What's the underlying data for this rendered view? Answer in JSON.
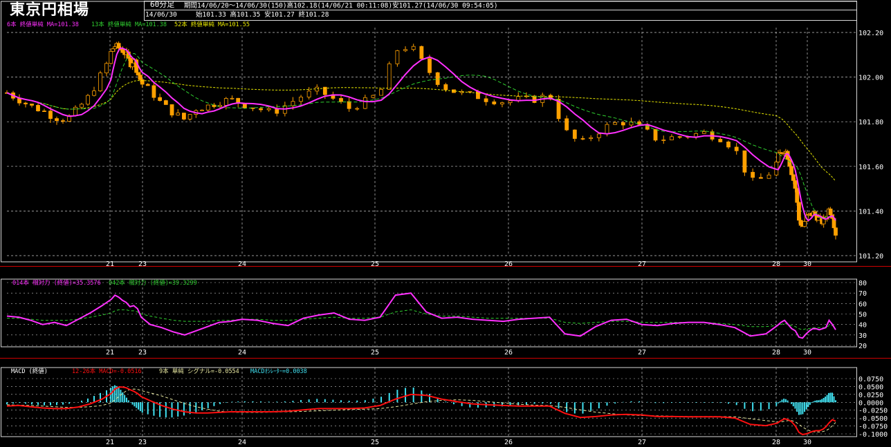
{
  "window": {
    "title": "東京円相場",
    "timeframe": "60分足",
    "period_info": "期間14/06/20～14/06/30(150)高102.18(14/06/21 00:11:08)安101.27(14/06/30 09:54:05)",
    "last_date": "14/06/30",
    "last_ohlc": "始101.33 高101.35 安101.27 終101.28"
  },
  "colors": {
    "background": "#000000",
    "grid": "#c8c8c8",
    "candle": "#ffa000",
    "ma6": "#ff30ff",
    "ma13": "#30d030",
    "ma52": "#e8e800",
    "rsi14": "#ff30ff",
    "rsi42": "#30d030",
    "macd": "#ff1010",
    "signal": "#e8e8a0",
    "histogram": "#40e0f0",
    "divider": "#d00000"
  },
  "price_panel": {
    "legend": [
      {
        "text": "6本 終値単純 MA=101.38",
        "color": "#ff30ff"
      },
      {
        "text": "13本 終値単純 MA=101.38",
        "color": "#30d030"
      },
      {
        "text": "52本 終値単純 MA=101.55",
        "color": "#e8e800"
      }
    ],
    "y_ticks": [
      "102.20",
      "102.00",
      "101.80",
      "101.60",
      "101.40",
      "101.20"
    ]
  },
  "rsi_panel": {
    "legend": [
      {
        "text": "014本 相対力 (終値)=35.3576",
        "color": "#ff30ff"
      },
      {
        "text": "042本 相対力 (終値)=39.3299",
        "color": "#30d030"
      }
    ],
    "y_ticks": [
      "80",
      "70",
      "60",
      "50",
      "40",
      "30",
      "20"
    ]
  },
  "macd_panel": {
    "legend": [
      {
        "text": "MACD (終値)",
        "color": "#ffffff"
      },
      {
        "text": "12-26本 MACD=-0.0516",
        "color": "#ff1010"
      },
      {
        "text": "9本 単純 シグナル=-0.0554",
        "color": "#e8e8a0"
      },
      {
        "text": "MACDｵｼﾚｰﾀｰ=0.0038",
        "color": "#40e0f0"
      }
    ],
    "y_ticks": [
      "0.0750",
      "0.0500",
      "0.0250",
      "0.0000",
      "-0.0250",
      "-0.0500",
      "-0.0750",
      "-0.1000"
    ]
  },
  "x_axis": {
    "date_labels": [
      "21",
      "23",
      "24",
      "25",
      "26",
      "27",
      "28",
      "30"
    ]
  },
  "chart_data": [
    {
      "type": "candlestick",
      "title": "東京円相場",
      "timeframe": "60分足",
      "x_dates": [
        "14/06/20",
        "14/06/21",
        "14/06/23",
        "14/06/24",
        "14/06/25",
        "14/06/26",
        "14/06/27",
        "14/06/28",
        "14/06/30"
      ],
      "ylim": [
        101.2,
        102.2
      ],
      "y_ticks": [
        102.2,
        102.0,
        101.8,
        101.6,
        101.4,
        101.2
      ],
      "close_path": [
        101.93,
        101.9,
        101.87,
        101.85,
        101.82,
        101.81,
        101.86,
        101.92,
        102.02,
        102.12,
        102.14,
        102.13,
        102.12,
        102.1,
        102.06,
        102.08,
        102.02,
        101.98,
        101.94,
        101.88,
        101.84,
        101.81,
        101.86,
        101.87,
        101.89,
        101.9,
        101.88,
        101.86,
        101.84,
        101.88,
        101.92,
        101.94,
        101.9,
        101.86,
        101.89,
        101.93,
        102.12,
        102.14,
        102.04,
        101.96,
        101.93,
        101.92,
        101.9,
        101.89,
        101.9,
        101.9,
        101.92,
        101.76,
        101.7,
        101.75,
        101.79,
        101.8,
        101.77,
        101.72,
        101.73,
        101.74,
        101.75,
        101.73,
        101.68,
        101.53,
        101.55,
        101.64,
        101.66,
        101.68,
        101.64,
        101.57,
        101.5,
        101.36,
        101.33,
        101.37,
        101.38,
        101.39,
        101.38,
        101.36,
        101.35,
        101.37,
        101.41,
        101.38,
        101.3
      ],
      "session_high": 102.18,
      "session_low": 101.27,
      "series": [
        {
          "name": "6本 終値単純",
          "last": 101.38
        },
        {
          "name": "13本 終値単純",
          "last": 101.38
        },
        {
          "name": "52本 終値単純",
          "last": 101.55
        }
      ],
      "last_bar": {
        "date": "14/06/30",
        "open": 101.33,
        "high": 101.35,
        "low": 101.27,
        "close": 101.28
      }
    },
    {
      "type": "line",
      "ylim": [
        20,
        80
      ],
      "y_ticks": [
        80,
        70,
        60,
        50,
        40,
        30,
        20
      ],
      "series": [
        {
          "name": "014本 相対力 (終値)",
          "last": 35.3576,
          "values": [
            48,
            47,
            44,
            40,
            42,
            39,
            45,
            51,
            58,
            64,
            68,
            66,
            63,
            61,
            57,
            58,
            55,
            47,
            40,
            37,
            33,
            30,
            34,
            38,
            42,
            43,
            45,
            44,
            41,
            39,
            46,
            49,
            51,
            45,
            44,
            47,
            68,
            70,
            52,
            46,
            47,
            45,
            44,
            43,
            45,
            46,
            47,
            31,
            29,
            38,
            44,
            45,
            40,
            39,
            41,
            42,
            42,
            40,
            37,
            29,
            31,
            39,
            42,
            44,
            40,
            36,
            34,
            28,
            27,
            31,
            34,
            36,
            36,
            35,
            36,
            37,
            44,
            40,
            35
          ]
        },
        {
          "name": "042本 相対力 (終値)",
          "last": 39.3299,
          "values": [
            46,
            46,
            45,
            44,
            44,
            44,
            45,
            47,
            49,
            51,
            53,
            54,
            54,
            54,
            53,
            53,
            52,
            50,
            48,
            46,
            44,
            43,
            43,
            43,
            44,
            44,
            45,
            45,
            44,
            44,
            45,
            46,
            47,
            46,
            46,
            47,
            52,
            54,
            50,
            48,
            48,
            47,
            46,
            46,
            46,
            46,
            46,
            42,
            41,
            42,
            43,
            43,
            42,
            42,
            42,
            42,
            42,
            41,
            40,
            38,
            38,
            39,
            40,
            41,
            40,
            39,
            38,
            36,
            35,
            36,
            36,
            37,
            37,
            37,
            37,
            37,
            39,
            39,
            39
          ]
        }
      ]
    },
    {
      "type": "line",
      "title": "MACD (終値)",
      "ylim": [
        -0.1,
        0.075
      ],
      "y_ticks": [
        0.075,
        0.05,
        0.025,
        0.0,
        -0.025,
        -0.05,
        -0.075,
        -0.1
      ],
      "series": [
        {
          "name": "12-26本 MACD",
          "last": -0.0516,
          "values": [
            -0.012,
            -0.01,
            -0.014,
            -0.018,
            -0.02,
            -0.02,
            -0.015,
            -0.005,
            0.01,
            0.028,
            0.042,
            0.048,
            0.048,
            0.046,
            0.04,
            0.035,
            0.028,
            0.018,
            0.005,
            -0.01,
            -0.022,
            -0.03,
            -0.034,
            -0.034,
            -0.032,
            -0.03,
            -0.03,
            -0.03,
            -0.03,
            -0.028,
            -0.024,
            -0.02,
            -0.02,
            -0.02,
            -0.018,
            -0.01,
            0.01,
            0.025,
            0.022,
            0.01,
            0.002,
            -0.005,
            -0.008,
            -0.01,
            -0.012,
            -0.012,
            -0.012,
            -0.035,
            -0.048,
            -0.045,
            -0.04,
            -0.038,
            -0.04,
            -0.045,
            -0.045,
            -0.046,
            -0.046,
            -0.046,
            -0.05,
            -0.07,
            -0.074,
            -0.066,
            -0.058,
            -0.052,
            -0.055,
            -0.062,
            -0.075,
            -0.095,
            -0.102,
            -0.1,
            -0.096,
            -0.092,
            -0.09,
            -0.09,
            -0.086,
            -0.078,
            -0.065,
            -0.055,
            -0.06
          ]
        },
        {
          "name": "9本 単純 シグナル",
          "last": -0.0554,
          "values": [
            -0.008,
            -0.009,
            -0.01,
            -0.012,
            -0.014,
            -0.016,
            -0.016,
            -0.014,
            -0.01,
            -0.002,
            0.008,
            0.018,
            0.028,
            0.036,
            0.04,
            0.042,
            0.041,
            0.037,
            0.03,
            0.02,
            0.008,
            -0.004,
            -0.014,
            -0.022,
            -0.028,
            -0.031,
            -0.032,
            -0.032,
            -0.031,
            -0.03,
            -0.029,
            -0.027,
            -0.025,
            -0.023,
            -0.022,
            -0.02,
            -0.014,
            -0.006,
            0.002,
            0.006,
            0.008,
            0.006,
            0.002,
            -0.002,
            -0.006,
            -0.009,
            -0.01,
            -0.016,
            -0.024,
            -0.031,
            -0.036,
            -0.04,
            -0.042,
            -0.043,
            -0.044,
            -0.045,
            -0.045,
            -0.045,
            -0.046,
            -0.052,
            -0.058,
            -0.062,
            -0.062,
            -0.06,
            -0.058,
            -0.058,
            -0.062,
            -0.07,
            -0.078,
            -0.085,
            -0.09,
            -0.093,
            -0.094,
            -0.094,
            -0.093,
            -0.09,
            -0.084,
            -0.074,
            -0.064
          ]
        },
        {
          "name": "MACDｵｼﾚｰﾀｰ",
          "last": 0.0038
        }
      ]
    }
  ]
}
